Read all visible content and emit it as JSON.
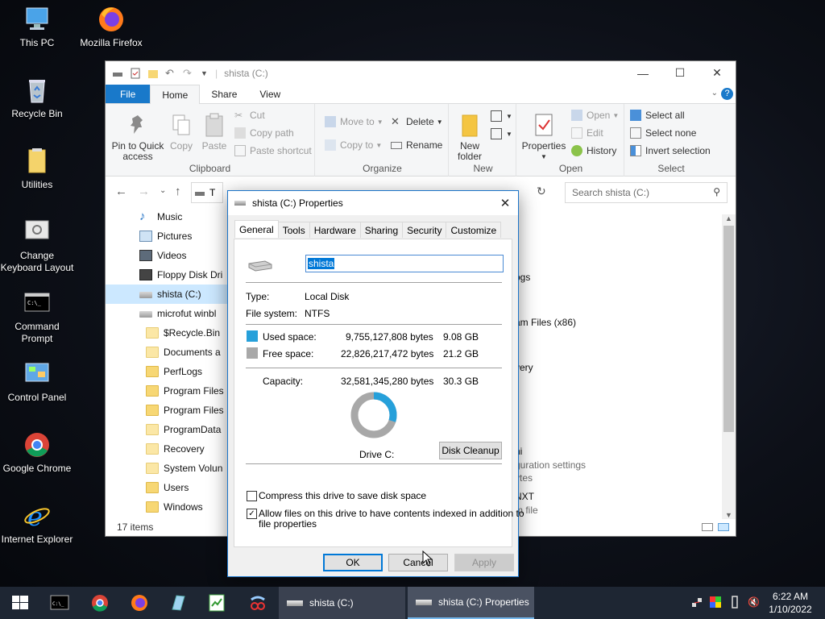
{
  "desktop": {
    "icons": [
      {
        "label": "This PC"
      },
      {
        "label": "Mozilla Firefox"
      },
      {
        "label": "Recycle Bin"
      },
      {
        "label": "Utilities"
      },
      {
        "label": "Change Keyboard Layout"
      },
      {
        "label": "Command Prompt"
      },
      {
        "label": "Control Panel"
      },
      {
        "label": "Google Chrome"
      },
      {
        "label": "Internet Explorer"
      }
    ]
  },
  "explorer": {
    "title": "shista (C:)",
    "tabs": {
      "file": "File",
      "home": "Home",
      "share": "Share",
      "view": "View"
    },
    "ribbon": {
      "clipboard": {
        "pin": "Pin to Quick access",
        "copy": "Copy",
        "paste": "Paste",
        "cut": "Cut",
        "copy_path": "Copy path",
        "paste_shortcut": "Paste shortcut",
        "group": "Clipboard"
      },
      "organize": {
        "move_to": "Move to",
        "copy_to": "Copy to",
        "delete": "Delete",
        "rename": "Rename",
        "group": "Organize"
      },
      "new": {
        "new_folder": "New folder",
        "group": "New"
      },
      "open": {
        "properties": "Properties",
        "open": "Open",
        "edit": "Edit",
        "history": "History",
        "group": "Open"
      },
      "select": {
        "select_all": "Select all",
        "select_none": "Select none",
        "invert": "Invert selection",
        "group": "Select"
      }
    },
    "address_prefix": "T",
    "search_placeholder": "Search shista (C:)",
    "nav": [
      {
        "label": "Music",
        "type": "music"
      },
      {
        "label": "Pictures",
        "type": "pictures"
      },
      {
        "label": "Videos",
        "type": "videos"
      },
      {
        "label": "Floppy Disk Dri",
        "type": "floppy"
      },
      {
        "label": "shista (C:)",
        "type": "drive",
        "selected": true
      },
      {
        "label": "microfut winbl",
        "type": "drive"
      },
      {
        "label": "$Recycle.Bin",
        "type": "folder-light"
      },
      {
        "label": "Documents a",
        "type": "folder-light"
      },
      {
        "label": "PerfLogs",
        "type": "folder"
      },
      {
        "label": "Program Files",
        "type": "folder"
      },
      {
        "label": "Program Files",
        "type": "folder"
      },
      {
        "label": "ProgramData",
        "type": "folder-light"
      },
      {
        "label": "Recovery",
        "type": "folder-light"
      },
      {
        "label": "System Volun",
        "type": "folder-light"
      },
      {
        "label": "Users",
        "type": "folder"
      },
      {
        "label": "Windows",
        "type": "folder"
      }
    ],
    "content_fragments": [
      "ogs",
      "am Files (x86)",
      "very",
      "ni",
      "guration settings",
      "ytes",
      "NXT",
      "m file"
    ],
    "status": "17 items"
  },
  "dialog": {
    "title": "shista (C:) Properties",
    "tabs": [
      "General",
      "Tools",
      "Hardware",
      "Sharing",
      "Security",
      "Customize"
    ],
    "name_value": "shista",
    "type_label": "Type:",
    "type_value": "Local Disk",
    "fs_label": "File system:",
    "fs_value": "NTFS",
    "used_label": "Used space:",
    "used_bytes": "9,755,127,808 bytes",
    "used_gb": "9.08 GB",
    "free_label": "Free space:",
    "free_bytes": "22,826,217,472 bytes",
    "free_gb": "21.2 GB",
    "capacity_label": "Capacity:",
    "capacity_bytes": "32,581,345,280 bytes",
    "capacity_gb": "30.3 GB",
    "used_fraction": 0.2994,
    "drive_label": "Drive C:",
    "cleanup": "Disk Cleanup",
    "compress": "Compress this drive to save disk space",
    "compress_checked": false,
    "index_line1": "Allow files on this drive to have contents indexed in addition to",
    "index_line2": "file properties",
    "index_checked": true,
    "ok": "OK",
    "cancel": "Cancel",
    "apply": "Apply",
    "colors": {
      "used": "#26a0da",
      "free": "#a8a8a8"
    }
  },
  "taskbar": {
    "tasks": [
      {
        "label": "shista (C:)"
      },
      {
        "label": "shista (C:) Properties"
      }
    ],
    "time": "6:22 AM",
    "date": "1/10/2022"
  }
}
